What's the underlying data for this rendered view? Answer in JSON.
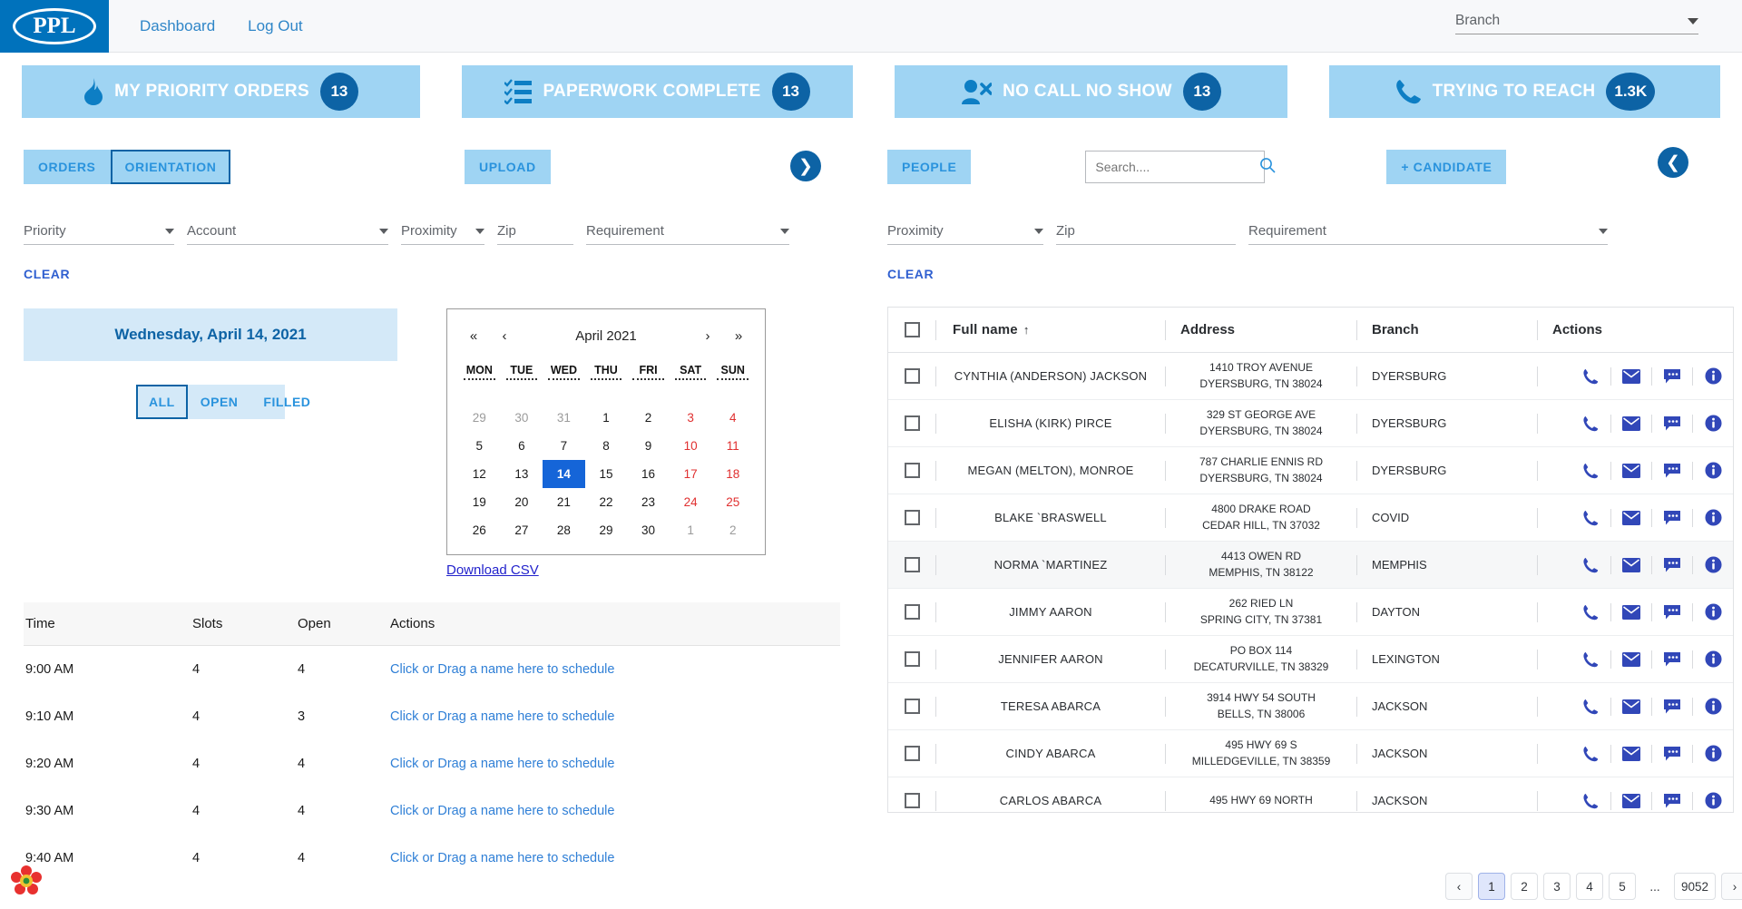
{
  "header": {
    "logo_text": "PPL",
    "nav": [
      {
        "label": "Dashboard"
      },
      {
        "label": "Log Out"
      }
    ],
    "branch_select": {
      "label": "Branch",
      "icon": "chevron-down-icon"
    }
  },
  "kpis": [
    {
      "label": "MY PRIORITY ORDERS",
      "count": "13",
      "icon": "flame-icon"
    },
    {
      "label": "PAPERWORK COMPLETE",
      "count": "13",
      "icon": "checklist-icon"
    },
    {
      "label": "NO CALL NO SHOW",
      "count": "13",
      "icon": "user-x-icon"
    },
    {
      "label": "TRYING TO REACH",
      "count": "1.3K",
      "icon": "phone-icon"
    }
  ],
  "left": {
    "tabs": [
      {
        "label": "ORDERS",
        "active": false
      },
      {
        "label": "ORIENTATION",
        "active": true
      }
    ],
    "upload_label": "UPLOAD",
    "next_arrow_icon": "chevron-right-circle-icon",
    "filters": [
      {
        "label": "Priority",
        "type": "select"
      },
      {
        "label": "Account",
        "type": "select"
      },
      {
        "label": "Proximity",
        "type": "select"
      },
      {
        "label": "Zip",
        "type": "input"
      },
      {
        "label": "Requirement",
        "type": "select"
      }
    ],
    "clear_label": "CLEAR",
    "date_header": "Wednesday, April 14, 2021",
    "segments": [
      {
        "label": "ALL",
        "active": true
      },
      {
        "label": "OPEN",
        "active": false
      },
      {
        "label": "FILLED",
        "active": false
      }
    ],
    "calendar": {
      "title": "April 2021",
      "nav": {
        "prev_year": "«",
        "prev_month": "‹",
        "next_month": "›",
        "next_year": "»"
      },
      "dow": [
        "MON",
        "TUE",
        "WED",
        "THU",
        "FRI",
        "SAT",
        "SUN"
      ],
      "weeks": [
        [
          {
            "d": "29",
            "state": "muted"
          },
          {
            "d": "30",
            "state": "muted"
          },
          {
            "d": "31",
            "state": "muted"
          },
          {
            "d": "1",
            "state": "normal"
          },
          {
            "d": "2",
            "state": "normal"
          },
          {
            "d": "3",
            "state": "weekend"
          },
          {
            "d": "4",
            "state": "weekend"
          }
        ],
        [
          {
            "d": "5",
            "state": "normal"
          },
          {
            "d": "6",
            "state": "normal"
          },
          {
            "d": "7",
            "state": "normal"
          },
          {
            "d": "8",
            "state": "normal"
          },
          {
            "d": "9",
            "state": "normal"
          },
          {
            "d": "10",
            "state": "weekend"
          },
          {
            "d": "11",
            "state": "weekend"
          }
        ],
        [
          {
            "d": "12",
            "state": "normal"
          },
          {
            "d": "13",
            "state": "normal"
          },
          {
            "d": "14",
            "state": "selected"
          },
          {
            "d": "15",
            "state": "normal"
          },
          {
            "d": "16",
            "state": "normal"
          },
          {
            "d": "17",
            "state": "weekend"
          },
          {
            "d": "18",
            "state": "weekend"
          }
        ],
        [
          {
            "d": "19",
            "state": "normal"
          },
          {
            "d": "20",
            "state": "normal"
          },
          {
            "d": "21",
            "state": "normal"
          },
          {
            "d": "22",
            "state": "normal"
          },
          {
            "d": "23",
            "state": "normal"
          },
          {
            "d": "24",
            "state": "weekend"
          },
          {
            "d": "25",
            "state": "weekend"
          }
        ],
        [
          {
            "d": "26",
            "state": "normal"
          },
          {
            "d": "27",
            "state": "normal"
          },
          {
            "d": "28",
            "state": "normal"
          },
          {
            "d": "29",
            "state": "normal"
          },
          {
            "d": "30",
            "state": "normal"
          },
          {
            "d": "1",
            "state": "muted"
          },
          {
            "d": "2",
            "state": "muted"
          }
        ]
      ]
    },
    "download_csv": "Download CSV",
    "schedule": {
      "columns": [
        "Time",
        "Slots",
        "Open",
        "Actions"
      ],
      "action_text": "Click or Drag a name here to schedule",
      "rows": [
        {
          "time": "9:00 AM",
          "slots": "4",
          "open": "4"
        },
        {
          "time": "9:10 AM",
          "slots": "4",
          "open": "3"
        },
        {
          "time": "9:20 AM",
          "slots": "4",
          "open": "4"
        },
        {
          "time": "9:30 AM",
          "slots": "4",
          "open": "4"
        },
        {
          "time": "9:40 AM",
          "slots": "4",
          "open": "4"
        }
      ]
    }
  },
  "right": {
    "people_label": "PEOPLE",
    "search": {
      "placeholder": "Search....",
      "value": "",
      "icon": "search-icon"
    },
    "add_candidate_label": "+ CANDIDATE",
    "back_arrow_icon": "chevron-left-circle-icon",
    "filters": [
      {
        "label": "Proximity",
        "type": "select"
      },
      {
        "label": "Zip",
        "type": "input"
      },
      {
        "label": "Requirement",
        "type": "select"
      }
    ],
    "clear_label": "CLEAR",
    "table": {
      "columns": [
        "Full name",
        "Address",
        "Branch",
        "Actions"
      ],
      "sort_column": "Full name",
      "sort_direction": "asc",
      "row_actions": [
        "phone-icon",
        "email-icon",
        "message-icon",
        "info-icon"
      ],
      "rows": [
        {
          "name": "CYNTHIA (ANDERSON) JACKSON",
          "address1": "1410 TROY AVENUE",
          "address2": "DYERSBURG, TN 38024",
          "branch": "DYERSBURG"
        },
        {
          "name": "ELISHA (KIRK) PIRCE",
          "address1": "329 ST GEORGE AVE",
          "address2": "DYERSBURG, TN 38024",
          "branch": "DYERSBURG"
        },
        {
          "name": "MEGAN (MELTON), MONROE",
          "address1": "787 CHARLIE ENNIS RD",
          "address2": "DYERSBURG, TN 38024",
          "branch": "DYERSBURG"
        },
        {
          "name": "BLAKE `BRASWELL",
          "address1": "4800 DRAKE ROAD",
          "address2": "CEDAR HILL, TN 37032",
          "branch": "COVID"
        },
        {
          "name": "NORMA `MARTINEZ",
          "address1": "4413 OWEN RD",
          "address2": "MEMPHIS, TN 38122",
          "branch": "MEMPHIS"
        },
        {
          "name": "JIMMY AARON",
          "address1": "262 RIED LN",
          "address2": "SPRING CITY, TN 37381",
          "branch": "DAYTON"
        },
        {
          "name": "JENNIFER AARON",
          "address1": "PO BOX 114",
          "address2": "DECATURVILLE, TN 38329",
          "branch": "LEXINGTON"
        },
        {
          "name": "TERESA ABARCA",
          "address1": "3914 HWY 54 SOUTH",
          "address2": "BELLS, TN 38006",
          "branch": "JACKSON"
        },
        {
          "name": "CINDY ABARCA",
          "address1": "495 HWY 69 S",
          "address2": "MILLEDGEVILLE, TN 38359",
          "branch": "JACKSON"
        },
        {
          "name": "CARLOS ABARCA",
          "address1": "495 HWY 69 NORTH",
          "address2": "",
          "branch": "JACKSON"
        }
      ]
    },
    "pagination": {
      "prev_icon": "chevron-left-icon",
      "next_icon": "chevron-right-icon",
      "pages": [
        "1",
        "2",
        "3",
        "4",
        "5"
      ],
      "ellipsis": "...",
      "last_page": "9052",
      "current": "1"
    }
  },
  "colors": {
    "brand_blue": "#0072bc",
    "kpi_card": "#9fd4f3",
    "badge_blue": "#0d63a5",
    "accent_link": "#2f7fd6",
    "weekend_red": "#e03030",
    "selected_day": "#1565d8"
  }
}
